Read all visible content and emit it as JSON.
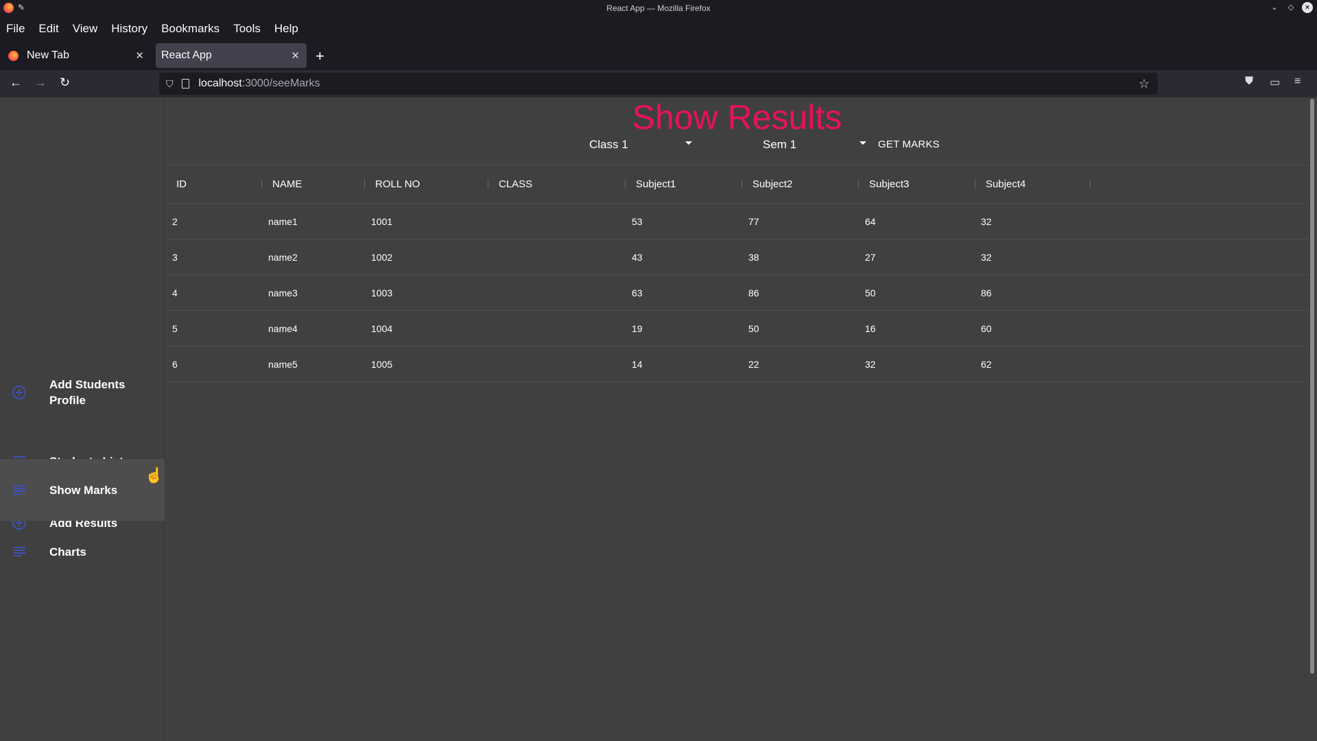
{
  "window": {
    "title": "React App — Mozilla Firefox"
  },
  "menu": [
    "File",
    "Edit",
    "View",
    "History",
    "Bookmarks",
    "Tools",
    "Help"
  ],
  "tabs": [
    {
      "label": "New Tab",
      "active": false
    },
    {
      "label": "React App",
      "active": true
    }
  ],
  "address": {
    "host": "localhost",
    "path": ":3000/seeMarks"
  },
  "sidebar": {
    "items": [
      {
        "label": "Add Students Profile",
        "icon": "add-circle-icon"
      },
      {
        "label": "Students List",
        "icon": "list-icon"
      },
      {
        "label": "Add Results",
        "icon": "add-circle-icon"
      },
      {
        "label": "Show Marks",
        "icon": "list-icon",
        "active": true
      },
      {
        "label": "Charts",
        "icon": "list-icon"
      }
    ]
  },
  "page": {
    "title": "Show Results",
    "class_select": "Class 1",
    "sem_select": "Sem 1",
    "get_marks": "GET MARKS"
  },
  "table": {
    "columns": [
      "ID",
      "NAME",
      "ROLL NO",
      "CLASS",
      "Subject1",
      "Subject2",
      "Subject3",
      "Subject4"
    ],
    "rows": [
      [
        "2",
        "name1",
        "1001",
        "",
        "53",
        "77",
        "64",
        "32"
      ],
      [
        "3",
        "name2",
        "1002",
        "",
        "43",
        "38",
        "27",
        "32"
      ],
      [
        "4",
        "name3",
        "1003",
        "",
        "63",
        "86",
        "50",
        "86"
      ],
      [
        "5",
        "name4",
        "1004",
        "",
        "19",
        "50",
        "16",
        "60"
      ],
      [
        "6",
        "name5",
        "1005",
        "",
        "14",
        "22",
        "32",
        "62"
      ]
    ]
  },
  "colors": {
    "accent": "#e8115c",
    "icon": "#3f51b5",
    "background": "#404040"
  }
}
